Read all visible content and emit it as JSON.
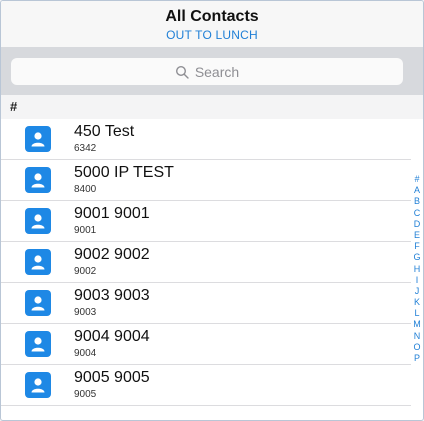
{
  "header": {
    "title": "All Contacts",
    "status": "OUT TO LUNCH"
  },
  "search": {
    "placeholder": "Search"
  },
  "section": {
    "letter": "#"
  },
  "contacts": [
    {
      "name": "450 Test",
      "number": "6342"
    },
    {
      "name": "5000 IP TEST",
      "number": "8400"
    },
    {
      "name": "9001 9001",
      "number": "9001"
    },
    {
      "name": "9002 9002",
      "number": "9002"
    },
    {
      "name": "9003 9003",
      "number": "9003"
    },
    {
      "name": "9004 9004",
      "number": "9004"
    },
    {
      "name": "9005 9005",
      "number": "9005"
    }
  ],
  "index_letters": [
    "#",
    "A",
    "B",
    "C",
    "D",
    "E",
    "F",
    "G",
    "H",
    "I",
    "J",
    "K",
    "L",
    "M",
    "N",
    "O",
    "P"
  ],
  "icons": {
    "search": "search-icon",
    "avatar": "person-icon"
  },
  "colors": {
    "accent": "#1f7fd6",
    "avatar": "#1e88e5"
  }
}
